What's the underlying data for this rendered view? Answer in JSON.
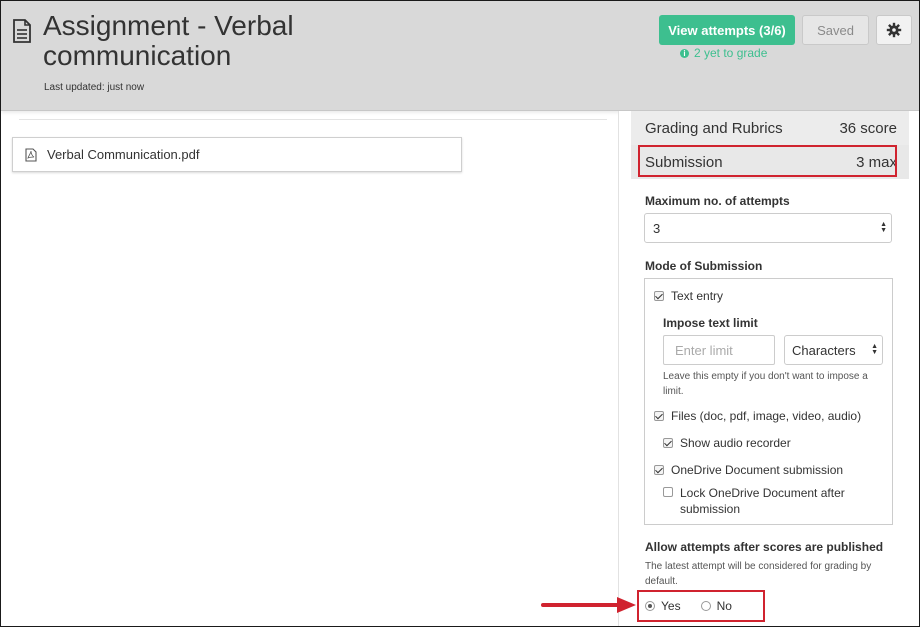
{
  "header": {
    "title": "Assignment - Verbal communication",
    "last_updated": "Last updated: just now",
    "view_attempts_label": "View attempts (3/6)",
    "to_grade_text": "2 yet to grade",
    "saved_label": "Saved",
    "icons": {
      "document": "document-icon",
      "settings": "gear-icon",
      "info": "info-icon"
    }
  },
  "main": {
    "attachment": {
      "filename": "Verbal Communication.pdf",
      "icon": "pdf-icon"
    }
  },
  "panel": {
    "grading": {
      "label": "Grading and Rubrics",
      "value": "36 score"
    },
    "submission": {
      "label": "Submission",
      "value": "3 max"
    },
    "max_attempts": {
      "label": "Maximum no. of attempts",
      "value": "3"
    },
    "mode": {
      "label": "Mode of Submission",
      "text_entry": {
        "label": "Text entry",
        "checked": true
      },
      "text_limit": {
        "label": "Impose text limit",
        "placeholder": "Enter limit",
        "unit": "Characters",
        "hint": "Leave this empty if you don't want to impose a limit."
      },
      "files": {
        "label": "Files (doc, pdf, image, video, audio)",
        "checked": true
      },
      "audio_recorder": {
        "label": "Show audio recorder",
        "checked": true
      },
      "onedrive": {
        "label": "OneDrive Document submission",
        "checked": true
      },
      "lock_onedrive": {
        "label": "Lock OneDrive Document after submission",
        "checked": false
      }
    },
    "allow_attempts": {
      "label": "Allow attempts after scores are published",
      "hint": "The latest attempt will be considered for grading by default.",
      "yes": "Yes",
      "no": "No",
      "selected": "Yes"
    }
  },
  "colors": {
    "accent_green": "#3dbf8f",
    "highlight_red": "#d0232f",
    "header_bg": "#d9d9d9"
  }
}
